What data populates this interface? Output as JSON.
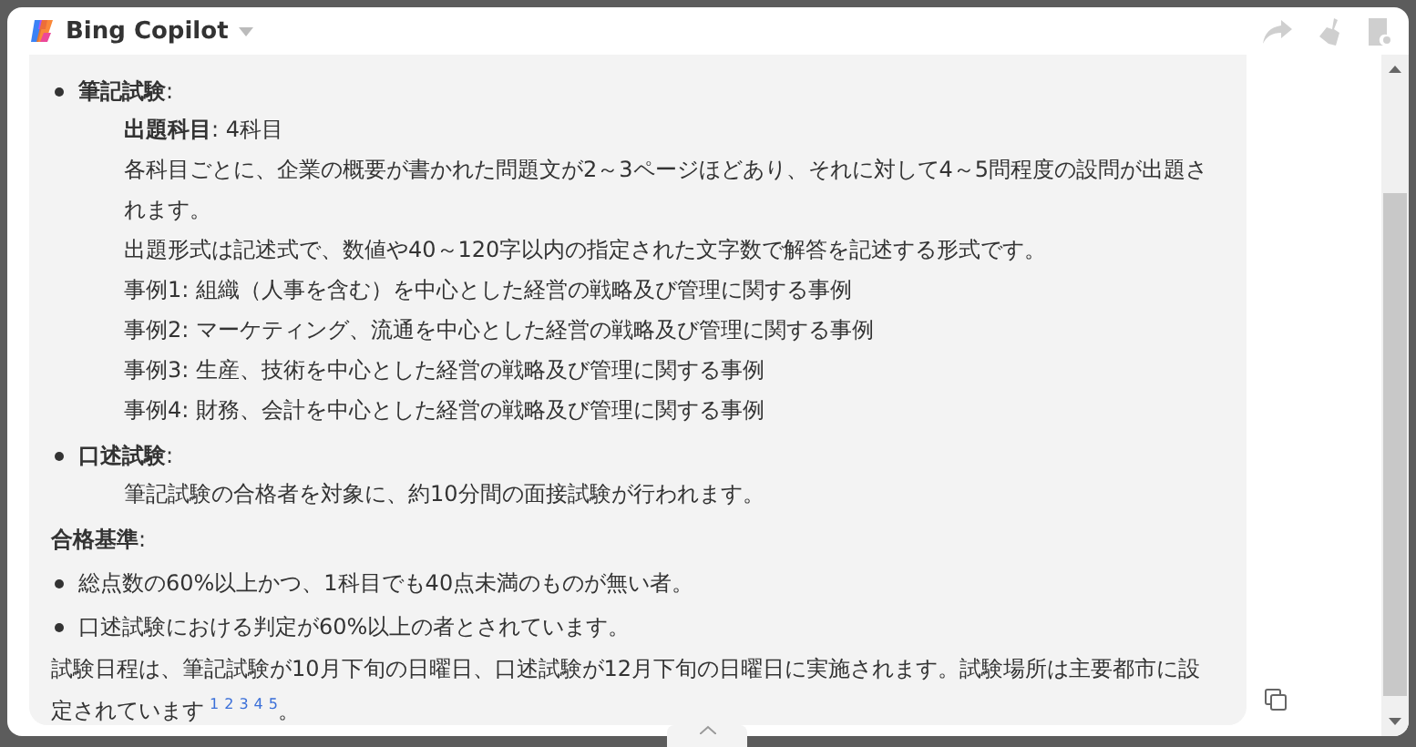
{
  "window": {
    "title": "Bing Copilot"
  },
  "answer": [
    {
      "kind": "bullet",
      "label": "**筆記試験**:",
      "lines": [
        "**出題科目**: 4科目",
        "各科目ごとに、企業の概要が書かれた問題文が2～3ページほどあり、それに対して4～5問程度の設問が出題されます。",
        "出題形式は記述式で、数値や40～120字以内の指定された文字数で解答を記述する形式です。",
        "事例1: 組織（人事を含む）を中心とした経営の戦略及び管理に関する事例",
        "事例2: マーケティング、流通を中心とした経営の戦略及び管理に関する事例",
        "事例3: 生産、技術を中心とした経営の戦略及び管理に関する事例",
        "事例4: 財務、会計を中心とした経営の戦略及び管理に関する事例"
      ]
    },
    {
      "kind": "bullet",
      "label": "**口述試験**:",
      "lines": [
        "筆記試験の合格者を対象に、約10分間の面接試験が行われます。"
      ]
    },
    {
      "kind": "heading",
      "label": "**合格基準**:"
    },
    {
      "kind": "bullet",
      "label": "総点数の60%以上かつ、1科目でも40点未満のものが無い者。"
    },
    {
      "kind": "bullet",
      "label": "口述試験における判定が60%以上の者とされています。"
    },
    {
      "kind": "paragraph",
      "label": "試験日程は、筆記試験が10月下旬の日曜日、口述試験が12月下旬の日曜日に実施されます。試験場所は主要都市に設定されています",
      "citations": [
        "1",
        "2",
        "3",
        "4",
        "5"
      ],
      "end": "。"
    }
  ]
}
